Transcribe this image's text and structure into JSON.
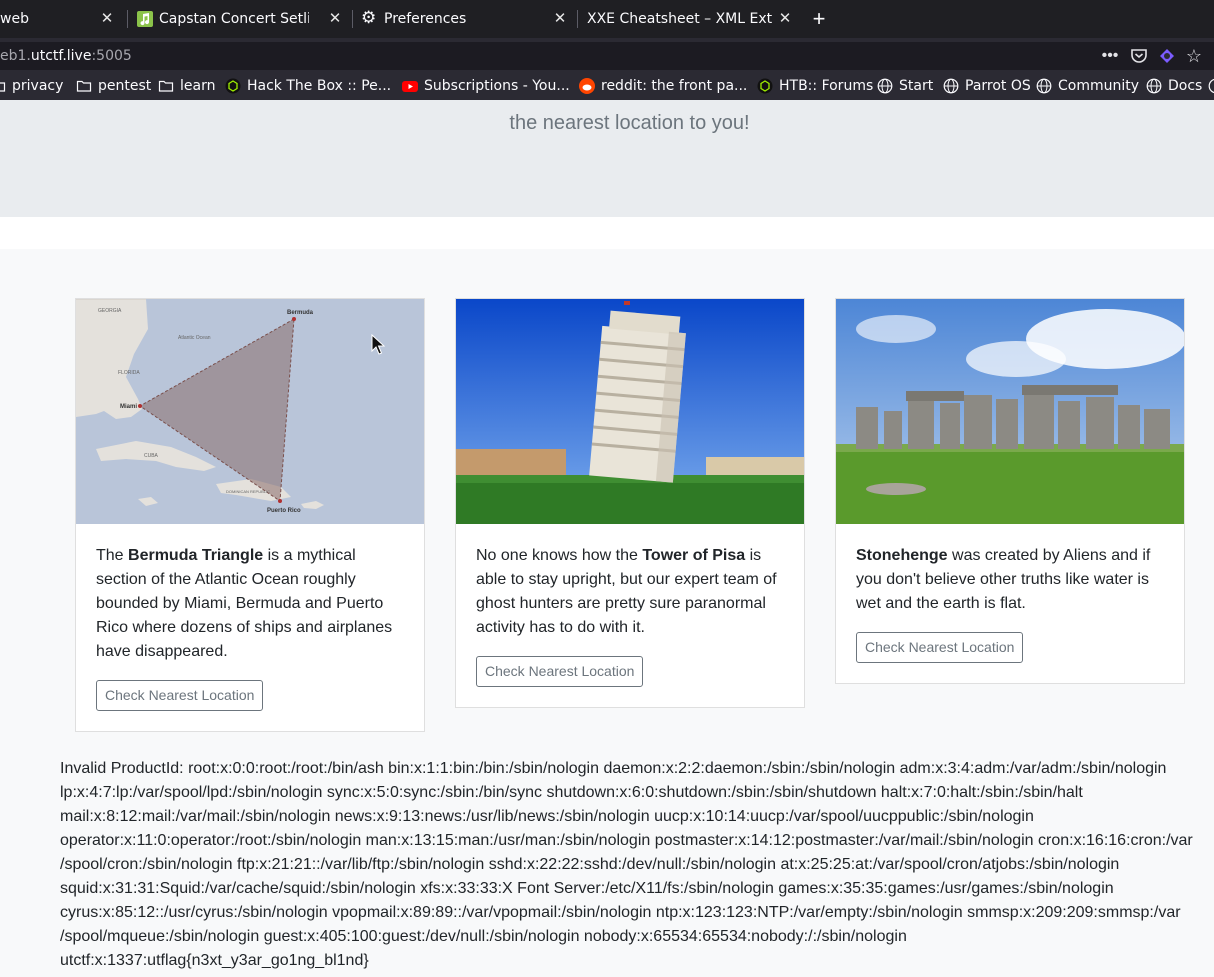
{
  "tabs": [
    {
      "label": "web",
      "active": false
    },
    {
      "label": "Capstan Concert Setlist",
      "active": false
    },
    {
      "label": "Preferences",
      "active": false
    },
    {
      "label": "XXE Cheatsheet – XML Exte",
      "active": false
    }
  ],
  "address_bar": {
    "prefix": "eb1.",
    "domain": "utctf.live",
    "port": ":5005"
  },
  "bookmarks": [
    {
      "label": "privacy",
      "icon": "folder-icon"
    },
    {
      "label": "pentest",
      "icon": "folder-icon"
    },
    {
      "label": "learn",
      "icon": "folder-icon"
    },
    {
      "label": "Hack The Box :: Pe...",
      "icon": "htb-icon"
    },
    {
      "label": "Subscriptions - You...",
      "icon": "youtube-icon"
    },
    {
      "label": "reddit: the front pa...",
      "icon": "reddit-icon"
    },
    {
      "label": "HTB:: Forums",
      "icon": "htb-icon"
    },
    {
      "label": "Start",
      "icon": "globe-icon"
    },
    {
      "label": "Parrot OS",
      "icon": "globe-icon"
    },
    {
      "label": "Community",
      "icon": "globe-icon"
    },
    {
      "label": "Docs",
      "icon": "globe-icon"
    }
  ],
  "hero": {
    "lead_line": "the nearest location to you!"
  },
  "cards": [
    {
      "pre": "The ",
      "bold": "Bermuda Triangle",
      "post": " is a mythical section of the Atlantic Ocean roughly bounded by Miami, Bermuda and Puerto Rico where dozens of ships and airplanes have disappeared.",
      "button": "Check Nearest Location",
      "map_labels": {
        "bermuda": "Bermuda",
        "miami": "Miami",
        "puerto_rico": "Puerto Rico",
        "florida": "FLORIDA",
        "georgia": "GEORGIA",
        "atlantic": "Atlantic Ocean",
        "cuba": "CUBA",
        "dominican": "DOMINICAN REPUBLIC"
      }
    },
    {
      "pre": "No one knows how the ",
      "bold": "Tower of Pisa",
      "post": " is able to stay upright, but our expert team of ghost hunters are pretty sure paranormal activity has to do with it.",
      "button": "Check Nearest Location"
    },
    {
      "pre": "",
      "bold": "Stonehenge",
      "post": " was created by Aliens and if you don't believe other truths like water is wet and the earth is flat.",
      "button": "Check Nearest Location"
    }
  ],
  "output_lines": [
    "Invalid ProductId: root:x:0:0:root:/root:/bin/ash bin:x:1:1:bin:/bin:/sbin/nologin daemon:x:2:2:daemon:/sbin:/sbin/nologin adm:x:3:4:adm:/var/adm:/sbin/nologin",
    "lp:x:4:7:lp:/var/spool/lpd:/sbin/nologin sync:x:5:0:sync:/sbin:/bin/sync shutdown:x:6:0:shutdown:/sbin:/sbin/shutdown halt:x:7:0:halt:/sbin:/sbin/halt",
    "mail:x:8:12:mail:/var/mail:/sbin/nologin news:x:9:13:news:/usr/lib/news:/sbin/nologin uucp:x:10:14:uucp:/var/spool/uucppublic:/sbin/nologin",
    "operator:x:11:0:operator:/root:/sbin/nologin man:x:13:15:man:/usr/man:/sbin/nologin postmaster:x:14:12:postmaster:/var/mail:/sbin/nologin cron:x:16:16:cron:/var",
    "/spool/cron:/sbin/nologin ftp:x:21:21::/var/lib/ftp:/sbin/nologin sshd:x:22:22:sshd:/dev/null:/sbin/nologin at:x:25:25:at:/var/spool/cron/atjobs:/sbin/nologin",
    "squid:x:31:31:Squid:/var/cache/squid:/sbin/nologin xfs:x:33:33:X Font Server:/etc/X11/fs:/sbin/nologin games:x:35:35:games:/usr/games:/sbin/nologin",
    "cyrus:x:85:12::/usr/cyrus:/sbin/nologin vpopmail:x:89:89::/var/vpopmail:/sbin/nologin ntp:x:123:123:NTP:/var/empty:/sbin/nologin smmsp:x:209:209:smmsp:/var",
    "/spool/mqueue:/sbin/nologin guest:x:405:100:guest:/dev/null:/sbin/nologin nobody:x:65534:65534:nobody:/:/sbin/nologin",
    "utctf:x:1337:utflag{n3xt_y3ar_go1ng_bl1nd}"
  ],
  "colors": {
    "chrome_dark": "#1f1f23",
    "toolbar": "#2b2a33",
    "hero": "#e9ecef",
    "page_bg": "#f8f9fa",
    "text": "#212529",
    "muted": "#6c757d"
  }
}
